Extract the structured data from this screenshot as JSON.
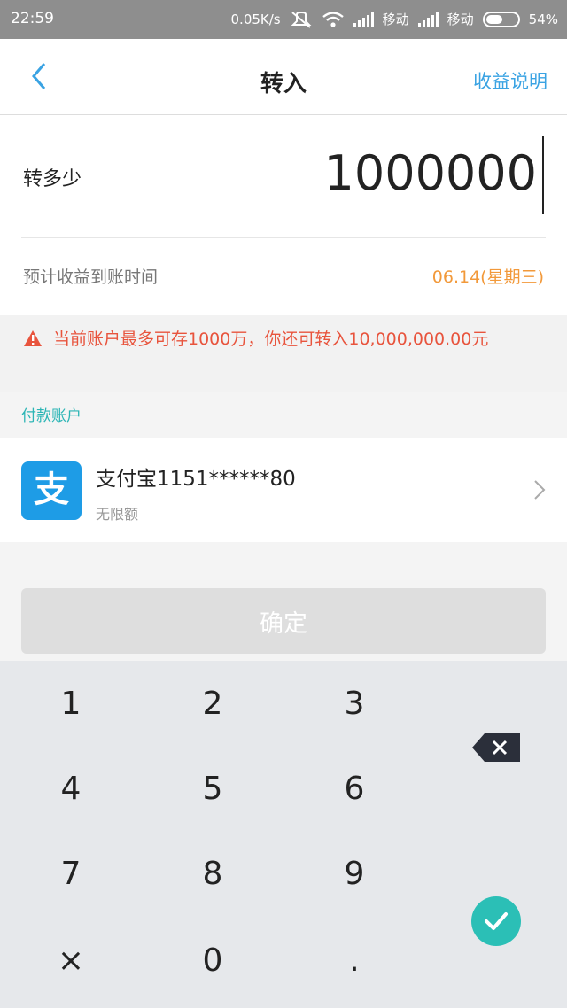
{
  "status_bar": {
    "time": "22:59",
    "speed": "0.05K/s",
    "carrier1": "移动",
    "carrier2": "移动",
    "battery": "54%",
    "battery_level": 0.54
  },
  "nav": {
    "title": "转入",
    "right_link": "收益说明",
    "back_icon": "chevron-left-icon"
  },
  "amount": {
    "label": "转多少",
    "value": "1000000",
    "arrival_label": "预计收益到账时间",
    "arrival_date": "06.14(星期三)"
  },
  "warning": {
    "icon": "warning-icon",
    "text": "当前账户最多可存1000万，你还可转入10,000,000.00元"
  },
  "payment": {
    "section_title": "付款账户",
    "logo_text": "支",
    "account_name": "支付宝1151******80",
    "limit_text": "无限额"
  },
  "confirm_label": "确定",
  "keypad": {
    "keys": [
      "1",
      "2",
      "3",
      "4",
      "5",
      "6",
      "7",
      "8",
      "9",
      "×",
      "0",
      "."
    ],
    "delete_icon": "backspace-icon",
    "ok_icon": "check-icon",
    "ok_color": "#2bbfb6"
  },
  "colors": {
    "accent": "#3aa3e3",
    "warning": "#e8543d",
    "date": "#f2993a",
    "teal": "#2bb5b5"
  }
}
